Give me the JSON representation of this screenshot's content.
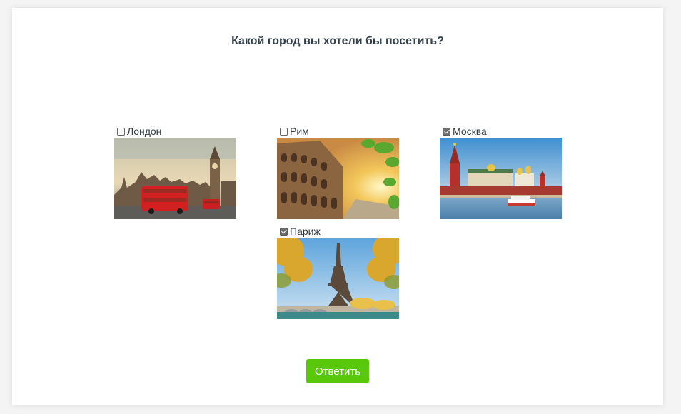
{
  "question": "Какой город вы хотели бы посетить?",
  "options": [
    {
      "label": "Лондон",
      "checked": false,
      "image": "london-big-ben-photo"
    },
    {
      "label": "Рим",
      "checked": false,
      "image": "rome-colosseum-photo"
    },
    {
      "label": "Москва",
      "checked": true,
      "image": "moscow-kremlin-photo"
    },
    {
      "label": "Париж",
      "checked": true,
      "image": "paris-eiffel-tower-photo"
    }
  ],
  "submit_label": "Ответить",
  "colors": {
    "accent": "#5ac80a",
    "title": "#35404d",
    "background": "#ffffff"
  }
}
